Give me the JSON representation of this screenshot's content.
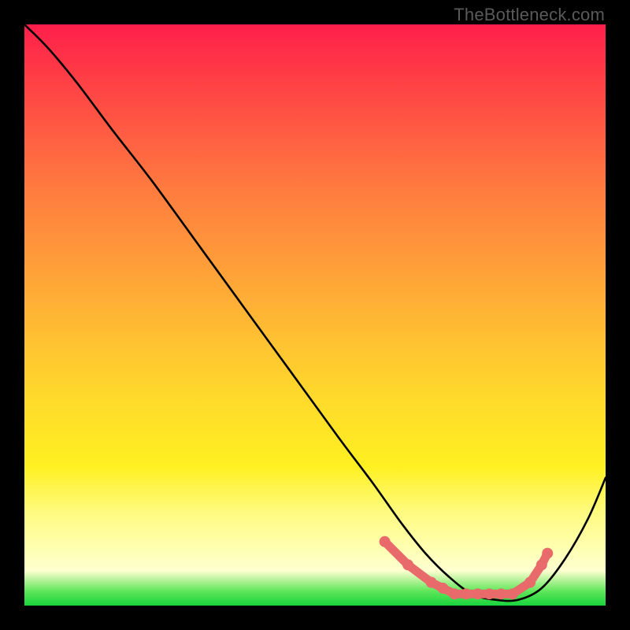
{
  "watermark": "TheBottleneck.com",
  "colors": {
    "background": "#000000",
    "curve": "#000000",
    "highlight": "#e86a6a",
    "gradient_top": "#ff1f4a",
    "gradient_bottom": "#18d43e"
  },
  "chart_data": {
    "type": "line",
    "title": "",
    "xlabel": "",
    "ylabel": "",
    "xlim": [
      0,
      100
    ],
    "ylim": [
      0,
      100
    ],
    "grid": false,
    "legend": null,
    "annotations": [
      "TheBottleneck.com"
    ],
    "series": [
      {
        "name": "main-curve",
        "x": [
          0,
          4,
          9,
          15,
          22,
          30,
          38,
          46,
          54,
          60,
          65,
          69,
          73,
          77,
          81,
          85,
          89,
          93,
          97,
          100
        ],
        "y": [
          100,
          96,
          90,
          82,
          73,
          62,
          51,
          40,
          29,
          21,
          14,
          9,
          5,
          2,
          1,
          1,
          3,
          8,
          15,
          22
        ]
      },
      {
        "name": "highlight-dots",
        "x": [
          62,
          66,
          70,
          72,
          74,
          76,
          78,
          80,
          82,
          84,
          87,
          89,
          90
        ],
        "y": [
          11,
          7,
          4,
          3,
          2,
          2,
          2,
          2,
          2,
          2,
          4,
          7,
          9
        ]
      }
    ]
  }
}
